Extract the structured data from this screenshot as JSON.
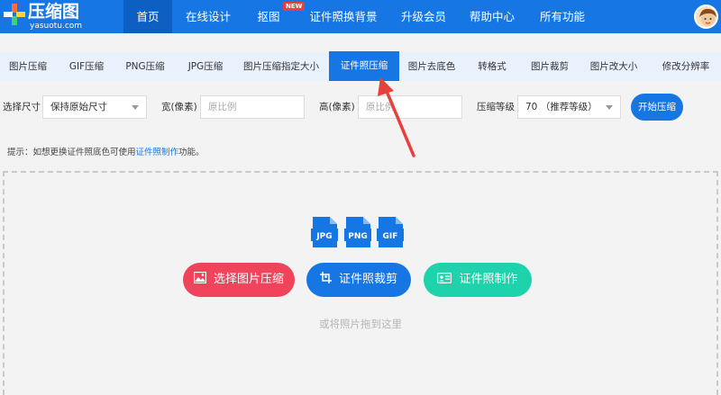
{
  "brand": {
    "title": "压缩图",
    "subtitle": "yasuotu.com"
  },
  "nav": {
    "items": [
      {
        "label": "首页"
      },
      {
        "label": "在线设计"
      },
      {
        "label": "抠图",
        "badge": "NEW"
      },
      {
        "label": "证件照换背景"
      },
      {
        "label": "升级会员"
      },
      {
        "label": "帮助中心"
      },
      {
        "label": "所有功能"
      }
    ]
  },
  "tabs": [
    {
      "label": "图片压缩"
    },
    {
      "label": "GIF压缩"
    },
    {
      "label": "PNG压缩"
    },
    {
      "label": "JPG压缩"
    },
    {
      "label": "图片压缩指定大小"
    },
    {
      "label": "证件照压缩"
    },
    {
      "label": "图片去底色"
    },
    {
      "label": "转格式"
    },
    {
      "label": "图片裁剪"
    },
    {
      "label": "图片改大小"
    },
    {
      "label": "修改分辨率"
    }
  ],
  "options": {
    "size_label": "选择尺寸",
    "size_value": "保持原始尺寸",
    "width_label": "宽(像素)",
    "width_placeholder": "原比例",
    "height_label": "高(像素)",
    "height_placeholder": "原比例",
    "level_label": "压缩等级",
    "level_value": "70 （推荐等级）",
    "start_button": "开始压缩"
  },
  "tip": {
    "prefix": "提示：如想更换证件照底色可使用",
    "link": "证件照制作",
    "suffix": "功能。"
  },
  "upload": {
    "formats": [
      "JPG",
      "PNG",
      "GIF"
    ],
    "actions": [
      {
        "label": "选择图片压缩",
        "color": "#f0445c"
      },
      {
        "label": "证件照裁剪",
        "color": "#1676e3"
      },
      {
        "label": "证件照制作",
        "color": "#1ed3ab"
      }
    ],
    "drag_hint": "或将照片拖到这里"
  },
  "colors": {
    "brand": "#1676e3",
    "arrow": "#e8403e"
  }
}
